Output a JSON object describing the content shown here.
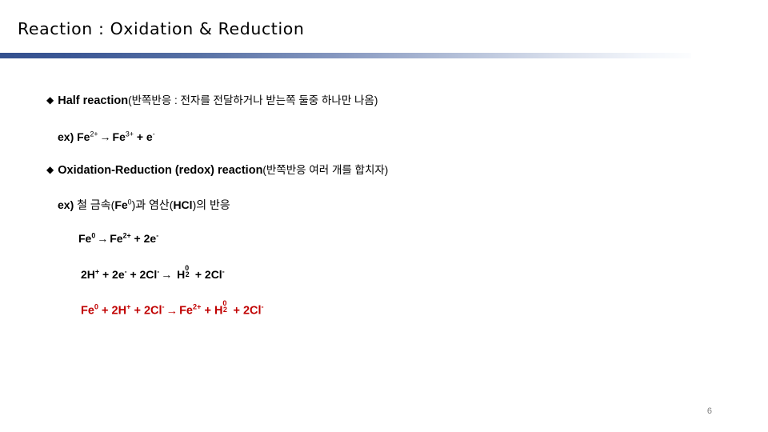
{
  "slide": {
    "title": "Reaction : Oxidation & Reduction",
    "page_number": "6",
    "accent_color_start": "#33508E",
    "accent_color_end": "#FCFDFE",
    "highlight_color": "#C00000",
    "page_number_color": "#7F7F7F"
  },
  "bullets": [
    {
      "marker": "◆",
      "heading": "Half reaction",
      "note_open": "(",
      "note": "반쪽반응 : 전자를 전달하거나 받는쪽 둘중 하나만 나옴",
      "note_close": ")"
    },
    {
      "marker": "◆",
      "heading": "Oxidation-Reduction (redox) reaction",
      "note_open": "(",
      "note": "반쪽반응 여러 개를 합치자",
      "note_close": ")"
    }
  ],
  "examples": {
    "ex1": {
      "label": "ex)",
      "species_1": "Fe",
      "charge_1": "2+",
      "arrow": "→",
      "species_2": "Fe",
      "charge_2": "3+",
      "plus": "+",
      "electron": "e",
      "electron_charge": "-"
    },
    "ex2": {
      "label": "ex)",
      "text_1": "철 금속(",
      "species_1": "Fe",
      "charge_1": "0",
      "text_2": ")과 염산(",
      "species_2": "HCl",
      "text_3": ")의 반응"
    }
  },
  "equations": {
    "eq1": {
      "left_species": "Fe",
      "left_charge": "0",
      "arrow": "→",
      "right_species": "Fe",
      "right_charge": "2+",
      "plus": "+",
      "electrons": "2e",
      "electron_charge": "-"
    },
    "eq2": {
      "h_coeff": "2H",
      "h_charge": "+",
      "plus_1": "+",
      "e_coeff": "2e",
      "e_charge": "-",
      "plus_2": "+",
      "cl_coeff": "2Cl",
      "cl_charge": "-",
      "arrow": "→",
      "h2_species": "H",
      "h2_sup": "0",
      "h2_sub": "2",
      "plus_3": "+",
      "cl_out": "2Cl",
      "cl_out_charge": "-"
    },
    "eq3_net": {
      "fe_species": "Fe",
      "fe_charge": "0",
      "plus_1": "+",
      "h_coeff": "2H",
      "h_charge": "+",
      "plus_2": "+",
      "cl_coeff": "2Cl",
      "cl_charge": "-",
      "arrow": "→",
      "fe_out": "Fe",
      "fe_out_charge": "2+",
      "plus_3": "+",
      "h2_species": "H",
      "h2_sup": "0",
      "h2_sub": "2",
      "plus_4": "+",
      "cl_out": "2Cl",
      "cl_out_charge": "-"
    }
  }
}
